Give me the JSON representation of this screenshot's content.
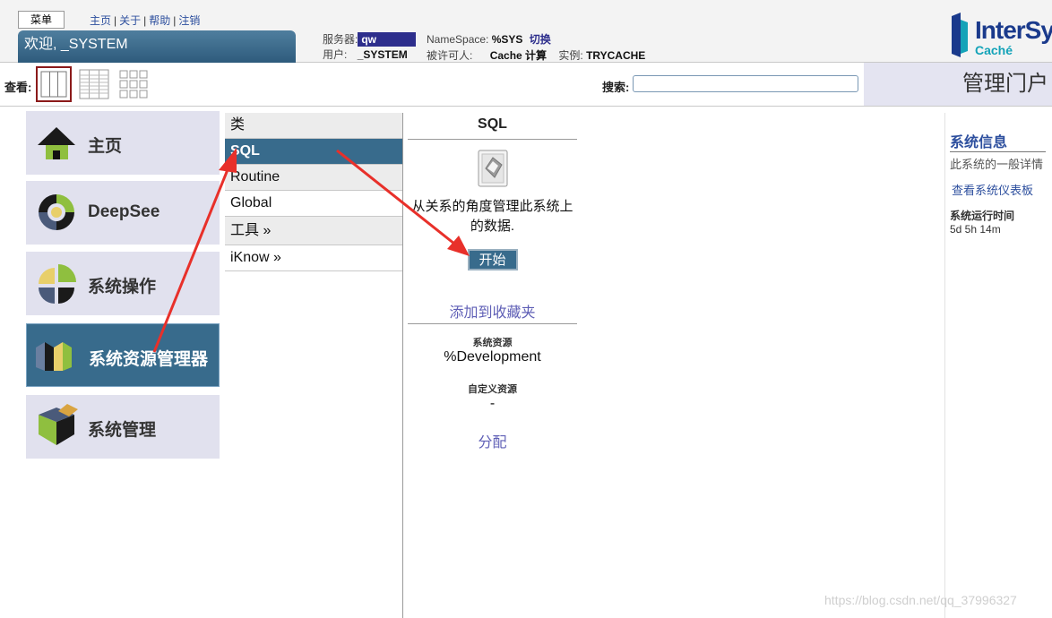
{
  "header": {
    "menu_label": "菜单",
    "links": [
      "主页",
      "关于",
      "帮助",
      "注销"
    ],
    "welcome": "欢迎, _SYSTEM",
    "server_label": "服务器:",
    "server_value": "qw",
    "user_label": "用户:",
    "user_value": "_SYSTEM",
    "namespace_label": "NameSpace:",
    "namespace_value": "%SYS",
    "switch_label": "切换",
    "licensee_label": "被许可人:",
    "licensee_value": "Cache 计算",
    "instance_label": "实例:",
    "instance_value": "TRYCACHE",
    "brand": "InterSy",
    "brand_sub": "Caché"
  },
  "toolbar": {
    "view_label": "查看:",
    "search_label": "搜索:",
    "search_value": "",
    "portal_title": "管理门户"
  },
  "nav": [
    {
      "label": "主页",
      "icon": "home-icon"
    },
    {
      "label": "DeepSee",
      "icon": "deepsee-icon"
    },
    {
      "label": "系统操作",
      "icon": "system-operation-icon"
    },
    {
      "label": "系统资源管理器",
      "icon": "system-explorer-icon",
      "active": true
    },
    {
      "label": "系统管理",
      "icon": "system-admin-icon"
    }
  ],
  "middle": {
    "items": [
      "类",
      "SQL",
      "Routine",
      "Global",
      "工具 »",
      "iKnow »"
    ]
  },
  "detail": {
    "title": "SQL",
    "icon": "sql-icon",
    "description": "从关系的角度管理此系统上的数据.",
    "start_label": "开始",
    "favorite_label": "添加到收藏夹",
    "resource_label": "系统资源",
    "resource_value": "%Development",
    "custom_resource_label": "自定义资源",
    "custom_resource_value": "-",
    "assign_label": "分配"
  },
  "sys_info": {
    "title": "系统信息",
    "subtitle": "此系统的一般详情",
    "dashboard_link": "查看系统仪表板",
    "uptime_label": "系统运行时间",
    "uptime_value": "5d 5h 14m"
  },
  "watermark": "https://blog.csdn.net/qq_37996327",
  "colors": {
    "accent": "#386b8c",
    "nav_tile": "#e1e1ee",
    "server_badge": "#2d2e8c",
    "link": "#5f5fb6",
    "annotation_arrow": "#e8302a"
  }
}
